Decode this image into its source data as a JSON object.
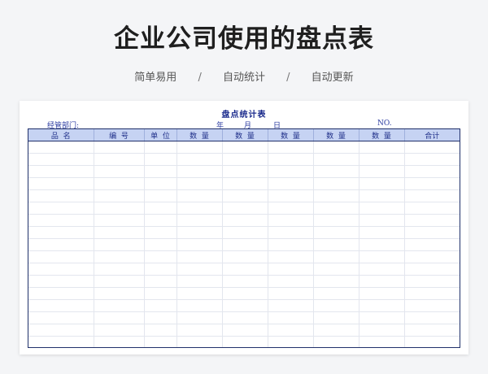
{
  "page": {
    "title": "企业公司使用的盘点表",
    "tags": [
      "简单易用",
      "自动统计",
      "自动更新"
    ],
    "separator": "/"
  },
  "sheet": {
    "title": "盘点统计表",
    "department_label": "经管部门:",
    "year_label": "年",
    "month_label": "月",
    "day_label": "日",
    "no_label": "NO.",
    "columns": [
      "品  名",
      "编  号",
      "单  位",
      "数  量",
      "数  量",
      "数  量",
      "数  量",
      "数  量",
      "合计"
    ],
    "empty_rows": 17
  }
}
